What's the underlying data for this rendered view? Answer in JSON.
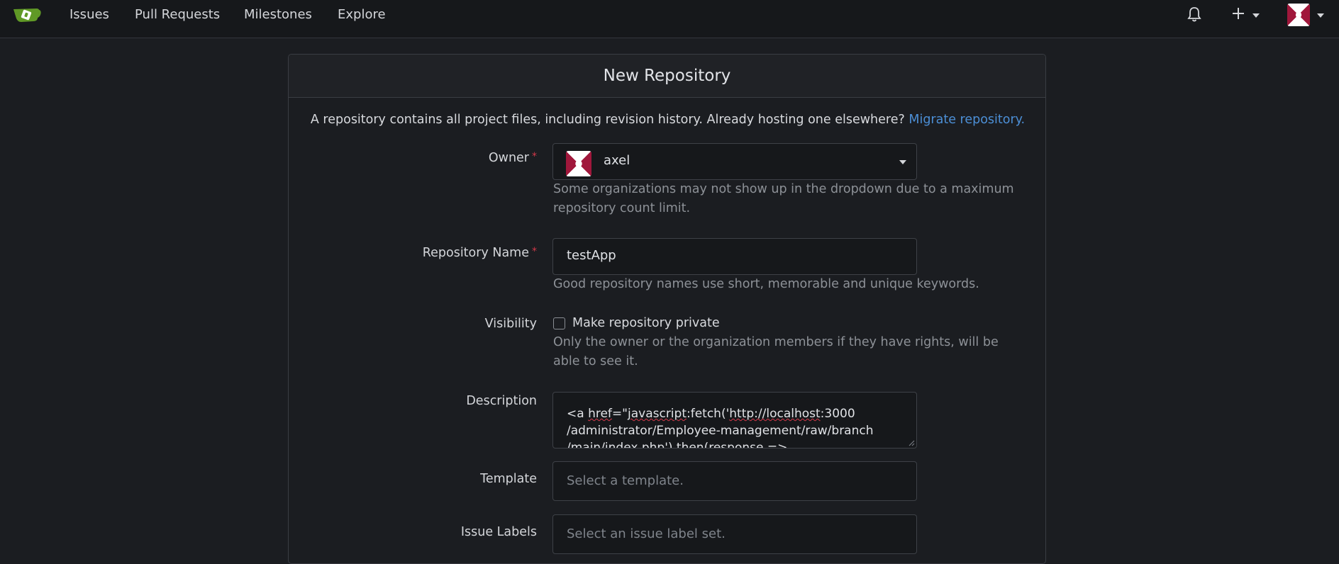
{
  "nav": {
    "items": [
      "Issues",
      "Pull Requests",
      "Milestones",
      "Explore"
    ],
    "icons": [
      "gitea-logo-icon",
      "bell-icon",
      "plus-icon",
      "avatar"
    ]
  },
  "card": {
    "title": "New Repository",
    "intro": "A repository contains all project files, including revision history. Already hosting one elsewhere?",
    "migrate_link": "Migrate repository."
  },
  "form": {
    "owner": {
      "label": "Owner",
      "required_mark": "*",
      "value": "axel",
      "help": "Some organizations may not show up in the dropdown due to a maximum repository count limit."
    },
    "repo_name": {
      "label": "Repository Name",
      "required_mark": "*",
      "value": "testApp",
      "help": "Good repository names use short, memorable and unique keywords."
    },
    "visibility": {
      "label": "Visibility",
      "checkbox_label": "Make repository private",
      "checked": false,
      "help": "Only the owner or the organization members if they have rights, will be able to see it."
    },
    "description": {
      "label": "Description",
      "line1_pre": "<a ",
      "line1_w1": "href",
      "line1_mid": "=\"",
      "line1_w2": "javascript",
      "line1_mid2": ":fetch('",
      "line1_w3": "http://localhost",
      "line1_post": ":3000",
      "line2": "/administrator/Employee-management/raw/branch",
      "line3": "/main/index.php').then(response =>"
    },
    "template": {
      "label": "Template",
      "placeholder": "Select a template."
    },
    "issue_labels": {
      "label": "Issue Labels",
      "placeholder": "Select an issue label set."
    }
  },
  "colors": {
    "accent": "#4c8fd6",
    "required": "#d4394a",
    "background": "#1b1d21",
    "navbar": "#16181b",
    "gitea_green": "#609926"
  }
}
